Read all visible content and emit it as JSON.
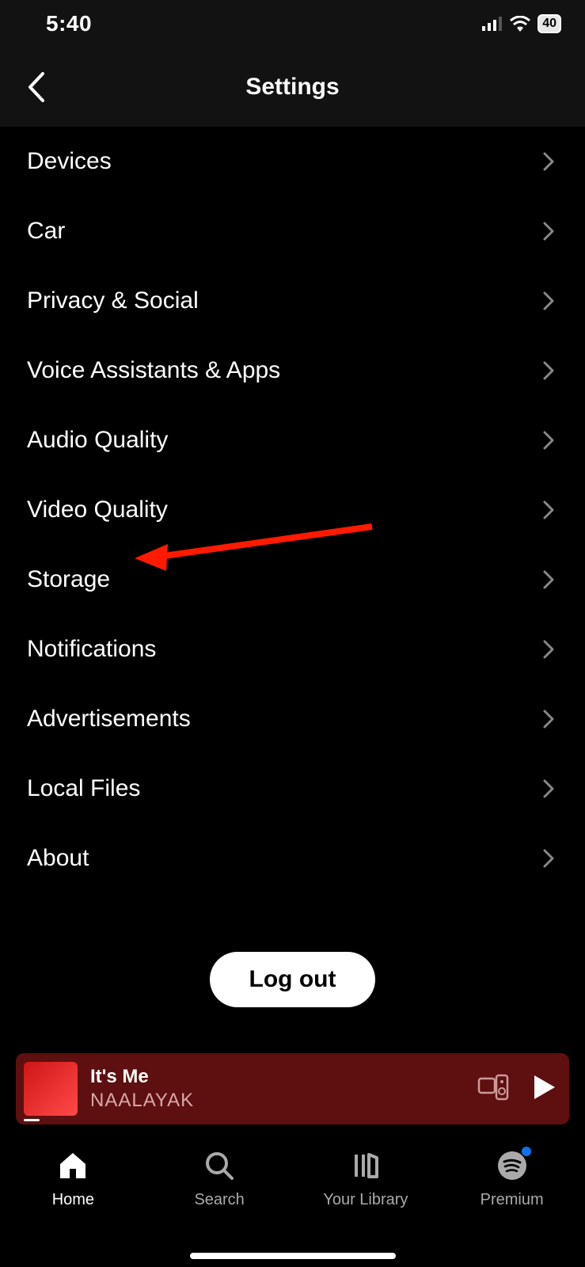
{
  "status": {
    "time": "5:40",
    "battery": "40"
  },
  "header": {
    "title": "Settings"
  },
  "items": [
    {
      "label": "Devices"
    },
    {
      "label": "Car"
    },
    {
      "label": "Privacy & Social"
    },
    {
      "label": "Voice Assistants & Apps"
    },
    {
      "label": "Audio Quality"
    },
    {
      "label": "Video Quality"
    },
    {
      "label": "Storage"
    },
    {
      "label": "Notifications"
    },
    {
      "label": "Advertisements"
    },
    {
      "label": "Local Files"
    },
    {
      "label": "About"
    }
  ],
  "logout_label": "Log out",
  "now_playing": {
    "title": "It's Me",
    "artist": "NAALAYAK"
  },
  "nav": {
    "home": "Home",
    "search": "Search",
    "library": "Your Library",
    "premium": "Premium"
  },
  "annotation": {
    "points_to": "Storage"
  }
}
